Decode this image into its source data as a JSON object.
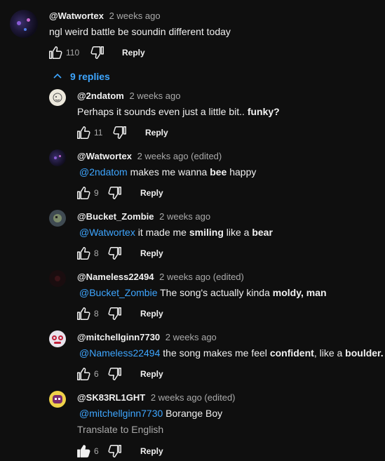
{
  "top_comment": {
    "author": "@Watwortex",
    "time": "2 weeks ago",
    "text": "ngl weird battle be soundin different today",
    "likes": "110",
    "reply_label": "Reply"
  },
  "replies_toggle": {
    "label": "9 replies"
  },
  "replies": [
    {
      "author": "@2ndatom",
      "time": "2 weeks ago",
      "mention": "",
      "text_pre": "Perhaps it sounds even just a little bit.. ",
      "text_bold": "funky?",
      "text_post": "",
      "likes": "11",
      "reply_label": "Reply"
    },
    {
      "author": "@Watwortex",
      "time": "2 weeks ago (edited)",
      "mention": "@2ndatom",
      "text_pre": " makes me wanna ",
      "text_bold": "bee",
      "text_post": " happy",
      "likes": "9",
      "reply_label": "Reply"
    },
    {
      "author": "@Bucket_Zombie",
      "time": "2 weeks ago",
      "mention": "@Watwortex",
      "text_pre": " it made me ",
      "text_bold": "smiling",
      "text_post": " like a ",
      "text_bold2": "bear",
      "likes": "8",
      "reply_label": "Reply"
    },
    {
      "author": "@Nameless22494",
      "time": "2 weeks ago (edited)",
      "mention": "@Bucket_Zombie",
      "text_pre": " The song's actually kinda ",
      "text_bold": "moldy, man",
      "text_post": "",
      "likes": "8",
      "reply_label": "Reply"
    },
    {
      "author": "@mitchellginn7730",
      "time": "2 weeks ago",
      "mention": "@Nameless22494",
      "text_pre": " the song makes me feel ",
      "text_bold": "confident",
      "text_post": ", like a ",
      "text_bold2": "boulder.",
      "likes": "6",
      "reply_label": "Reply"
    },
    {
      "author": "@SK83RL1GHT",
      "time": "2 weeks ago (edited)",
      "mention": "@mitchellginn7730",
      "text_pre": " Borange Boy",
      "text_bold": "",
      "text_post": "",
      "translate": "Translate to English",
      "likes": "6",
      "reply_label": "Reply"
    }
  ],
  "icons": {
    "like": "thumb-up-icon",
    "dislike": "thumb-down-icon",
    "collapse": "chevron-up-icon"
  },
  "colors": {
    "background": "#0f0f0f",
    "link": "#3ea6ff",
    "secondary": "#aaaaaa"
  }
}
